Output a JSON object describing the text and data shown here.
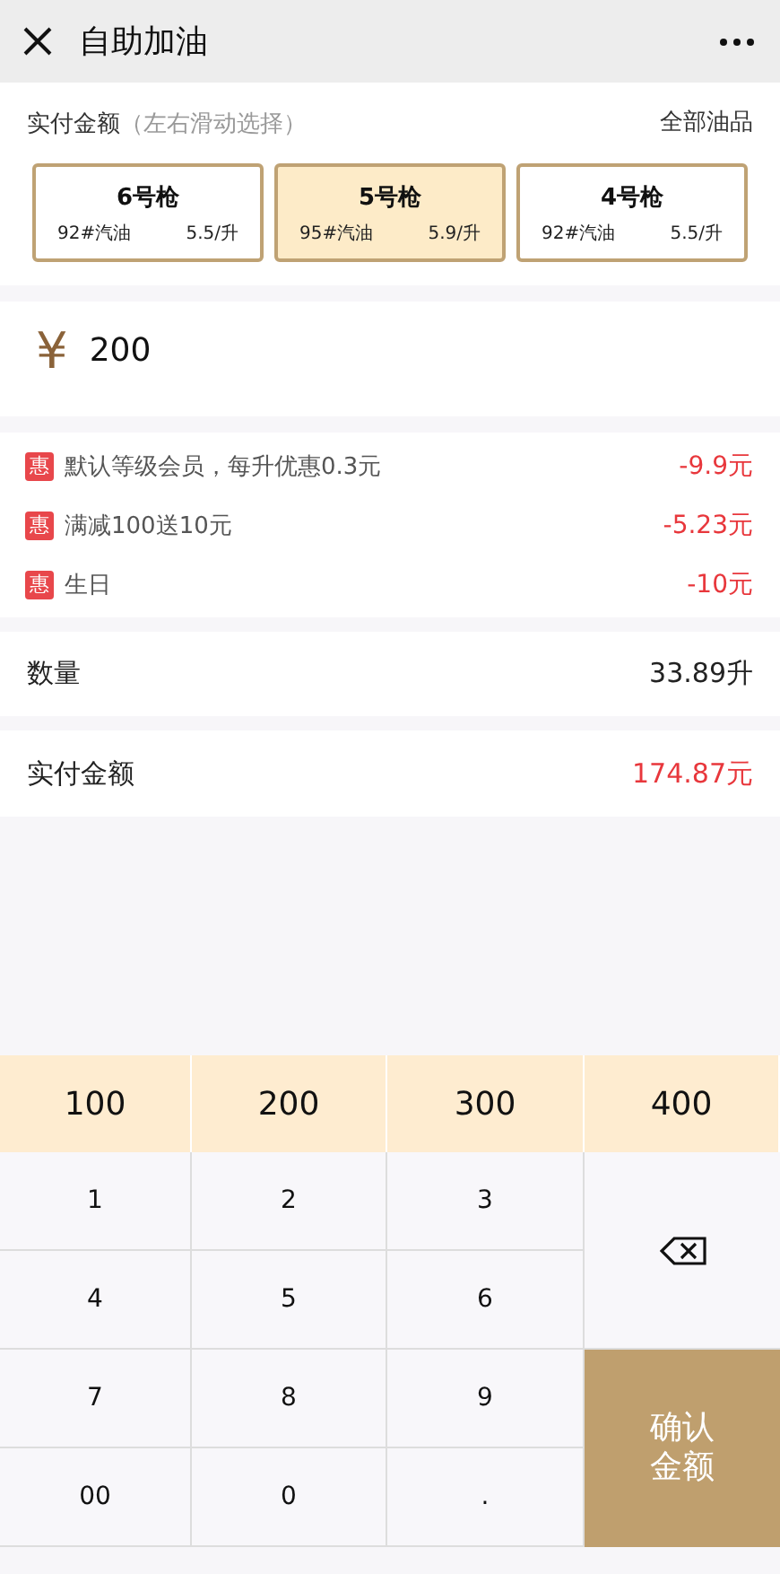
{
  "header": {
    "title": "自助加油"
  },
  "selector": {
    "label": "实付金额",
    "hint": "（左右滑动选择）",
    "link": "全部油品"
  },
  "pumps": [
    {
      "name": "6号枪",
      "fuel": "92#汽油",
      "price": "5.5/升",
      "selected": false
    },
    {
      "name": "5号枪",
      "fuel": "95#汽油",
      "price": "5.9/升",
      "selected": true
    },
    {
      "name": "4号枪",
      "fuel": "92#汽油",
      "price": "5.5/升",
      "selected": false
    }
  ],
  "amount": {
    "currency": "¥",
    "value": "200"
  },
  "discounts": [
    {
      "badge": "惠",
      "text": "默认等级会员，每升优惠0.3元",
      "amount": "-9.9元"
    },
    {
      "badge": "惠",
      "text": "满减100送10元",
      "amount": "-5.23元"
    },
    {
      "badge": "惠",
      "text": "生日",
      "amount": "-10元"
    }
  ],
  "quantity": {
    "label": "数量",
    "value": "33.89升"
  },
  "paid": {
    "label": "实付金额",
    "value": "174.87元"
  },
  "quick_amounts": [
    "100",
    "200",
    "300",
    "400"
  ],
  "keys": [
    "1",
    "2",
    "3",
    "4",
    "5",
    "6",
    "7",
    "8",
    "9",
    "00",
    "0",
    "."
  ],
  "confirm": {
    "line1": "确认",
    "line2": "金额"
  }
}
